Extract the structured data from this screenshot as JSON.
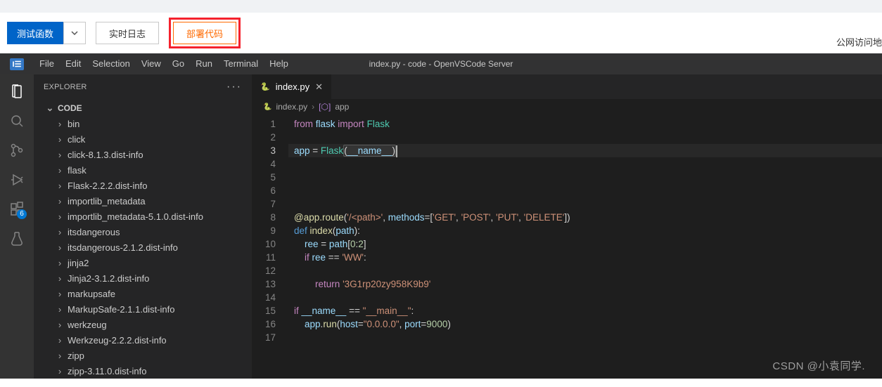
{
  "toolbar": {
    "test_fn": "测试函数",
    "realtime_log": "实时日志",
    "deploy_code": "部署代码",
    "public_access": "公网访问地"
  },
  "ide": {
    "logo": "I☰",
    "menu": [
      "File",
      "Edit",
      "Selection",
      "View",
      "Go",
      "Run",
      "Terminal",
      "Help"
    ],
    "title": "index.py - code - OpenVSCode Server",
    "explorer_label": "EXPLORER",
    "ext_badge": "6",
    "tree_root": "CODE",
    "tree": [
      "bin",
      "click",
      "click-8.1.3.dist-info",
      "flask",
      "Flask-2.2.2.dist-info",
      "importlib_metadata",
      "importlib_metadata-5.1.0.dist-info",
      "itsdangerous",
      "itsdangerous-2.1.2.dist-info",
      "jinja2",
      "Jinja2-3.1.2.dist-info",
      "markupsafe",
      "MarkupSafe-2.1.1.dist-info",
      "werkzeug",
      "Werkzeug-2.2.2.dist-info",
      "zipp",
      "zipp-3.11.0.dist-info"
    ],
    "tab_file": "index.py",
    "crumbs_file": "index.py",
    "crumbs_symbol": "app",
    "code_lines": 17,
    "current_line": 3,
    "code": {
      "l1_from": "from",
      "l1_flask": "flask",
      "l1_import": "import",
      "l1_Flask": "Flask",
      "l3_app": "app",
      "l3_eq": " = ",
      "l3_Flask": "Flask",
      "l3_dunder": "__name__",
      "l8_dec": "@app.route",
      "l8_s1": "'/<path>'",
      "l8_methods": "methods",
      "l8_s2": "'GET'",
      "l8_s3": "'POST'",
      "l8_s4": "'PUT'",
      "l8_s5": "'DELETE'",
      "l9_def": "def",
      "l9_name": "index",
      "l9_param": "path",
      "l10_ree": "ree",
      "l10_path": "path",
      "l10_slice0": "0",
      "l10_slice2": "2",
      "l11_if": "if",
      "l11_ree": "ree",
      "l11_s": "'WW'",
      "l13_ret": "return",
      "l13_s": "'3G1rp20zy958K9b9'",
      "l15_if": "if",
      "l15_name": "__name__",
      "l15_main": "\"__main__\"",
      "l16_app": "app",
      "l16_run": "run",
      "l16_host": "host",
      "l16_hs": "\"0.0.0.0\"",
      "l16_port": "port",
      "l16_pn": "9000"
    },
    "watermark": "CSDN @小袁同学."
  }
}
